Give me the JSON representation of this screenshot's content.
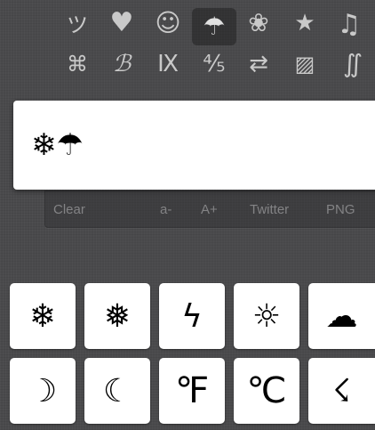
{
  "categories": [
    {
      "icon": "ツ",
      "name": "smiley-katakana-icon"
    },
    {
      "icon": "♥",
      "name": "heart-icon"
    },
    {
      "icon": "☺",
      "name": "smiley-face-icon"
    },
    {
      "icon": "☂",
      "name": "umbrella-icon",
      "active": true
    },
    {
      "icon": "❀",
      "name": "flower-icon"
    },
    {
      "icon": "★",
      "name": "star-icon"
    },
    {
      "icon": "♫",
      "name": "music-note-icon"
    },
    {
      "icon": "⌘",
      "name": "command-icon"
    },
    {
      "icon": "ℬ",
      "name": "script-b-icon"
    },
    {
      "icon": "Ⅸ",
      "name": "roman-numeral-icon"
    },
    {
      "icon": "⅘",
      "name": "fraction-icon"
    },
    {
      "icon": "⇄",
      "name": "arrows-icon"
    },
    {
      "icon": "▨",
      "name": "hatched-square-icon"
    },
    {
      "icon": "∬",
      "name": "double-integral-icon"
    }
  ],
  "editor": {
    "text": "❄☂"
  },
  "toolbar": {
    "clear": "Clear",
    "smaller": "a-",
    "larger": "A+",
    "twitter": "Twitter",
    "png": "PNG"
  },
  "symbols": [
    {
      "char": "❄",
      "name": "snowflake-symbol"
    },
    {
      "char": "❅",
      "name": "tight-snowflake-symbol"
    },
    {
      "char": "ϟ",
      "name": "lightning-symbol"
    },
    {
      "char": "☼",
      "name": "sun-symbol"
    },
    {
      "char": "☁",
      "name": "cloud-symbol"
    },
    {
      "char": "☽",
      "name": "first-quarter-moon-symbol"
    },
    {
      "char": "☾",
      "name": "last-quarter-moon-symbol"
    },
    {
      "char": "℉",
      "name": "fahrenheit-symbol"
    },
    {
      "char": "℃",
      "name": "celsius-symbol"
    },
    {
      "char": "☇",
      "name": "lightning-bolt-symbol"
    }
  ]
}
